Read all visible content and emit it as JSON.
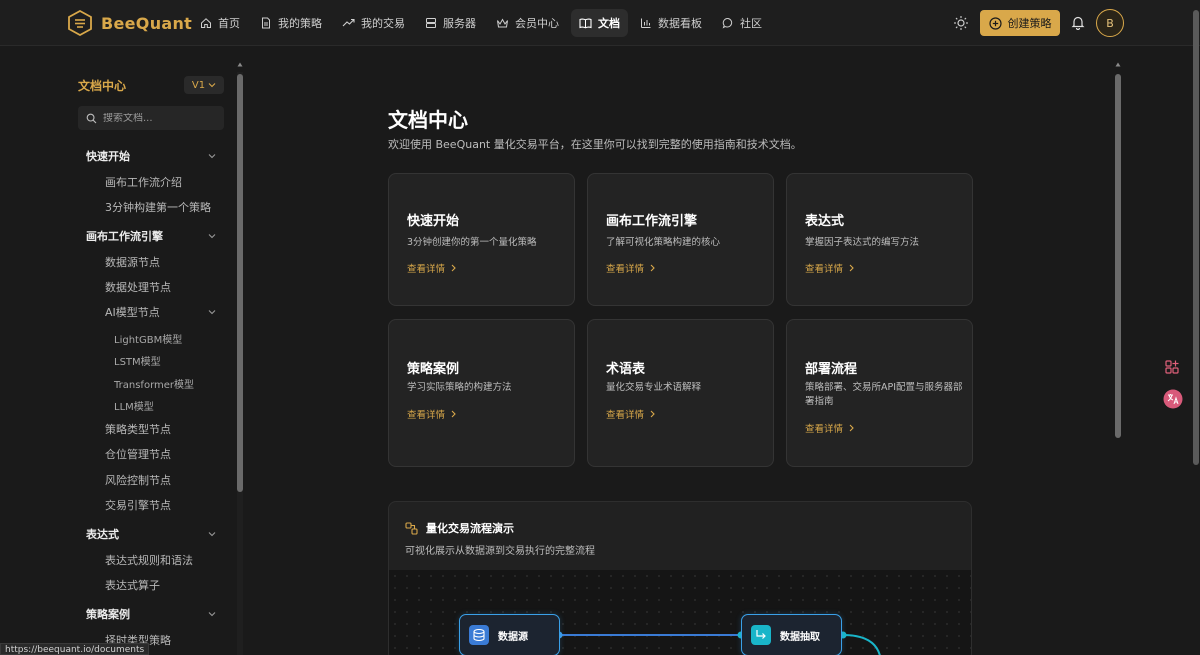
{
  "app": {
    "brand": "BeeQuant",
    "brand_color": "#d9a84a"
  },
  "nav": {
    "items": [
      {
        "label": "首页",
        "icon": "home-icon"
      },
      {
        "label": "我的策略",
        "icon": "document-icon"
      },
      {
        "label": "我的交易",
        "icon": "trend-up-icon"
      },
      {
        "label": "服务器",
        "icon": "server-icon"
      },
      {
        "label": "会员中心",
        "icon": "crown-icon"
      },
      {
        "label": "文档",
        "icon": "book-icon",
        "active": true
      },
      {
        "label": "数据看板",
        "icon": "bar-chart-icon"
      },
      {
        "label": "社区",
        "icon": "chat-icon"
      }
    ],
    "create_label": "创建策略",
    "avatar_letter": "B"
  },
  "sidebar": {
    "title": "文档中心",
    "version": "V1",
    "search_placeholder": "搜索文档...",
    "sections": [
      {
        "label": "快速开始",
        "items": [
          "画布工作流介绍",
          "3分钟构建第一个策略"
        ]
      },
      {
        "label": "画布工作流引擎",
        "items": [
          "数据源节点",
          "数据处理节点",
          "AI模型节点",
          "策略类型节点",
          "仓位管理节点",
          "风险控制节点",
          "交易引擎节点"
        ],
        "ai_children": [
          "LightGBM模型",
          "LSTM模型",
          "Transformer模型",
          "LLM模型"
        ]
      },
      {
        "label": "表达式",
        "items": [
          "表达式规则和语法",
          "表达式算子"
        ]
      },
      {
        "label": "策略案例",
        "items": [
          "择时类型策略"
        ]
      }
    ]
  },
  "main": {
    "title": "文档中心",
    "description": "欢迎使用 BeeQuant 量化交易平台，在这里你可以找到完整的使用指南和技术文档。",
    "link_label": "查看详情",
    "cards": [
      {
        "title": "快速开始",
        "desc": "3分钟创建你的第一个量化策略"
      },
      {
        "title": "画布工作流引擎",
        "desc": "了解可视化策略构建的核心"
      },
      {
        "title": "表达式",
        "desc": "掌握因子表达式的编写方法"
      },
      {
        "title": "策略案例",
        "desc": "学习实际策略的构建方法"
      },
      {
        "title": "术语表",
        "desc": "量化交易专业术语解释"
      },
      {
        "title": "部署流程",
        "desc": "策略部署、交易所API配置与服务器部署指南"
      }
    ],
    "flow": {
      "title": "量化交易流程演示",
      "description": "可视化展示从数据源到交易执行的完整流程",
      "nodes": [
        {
          "label": "数据源",
          "icon": "database-icon",
          "icon_color": "#3a7bd5"
        },
        {
          "label": "数据抽取",
          "icon": "extract-icon",
          "icon_color": "#19b5c9"
        }
      ]
    }
  },
  "status_url": "https://beequant.io/documents"
}
